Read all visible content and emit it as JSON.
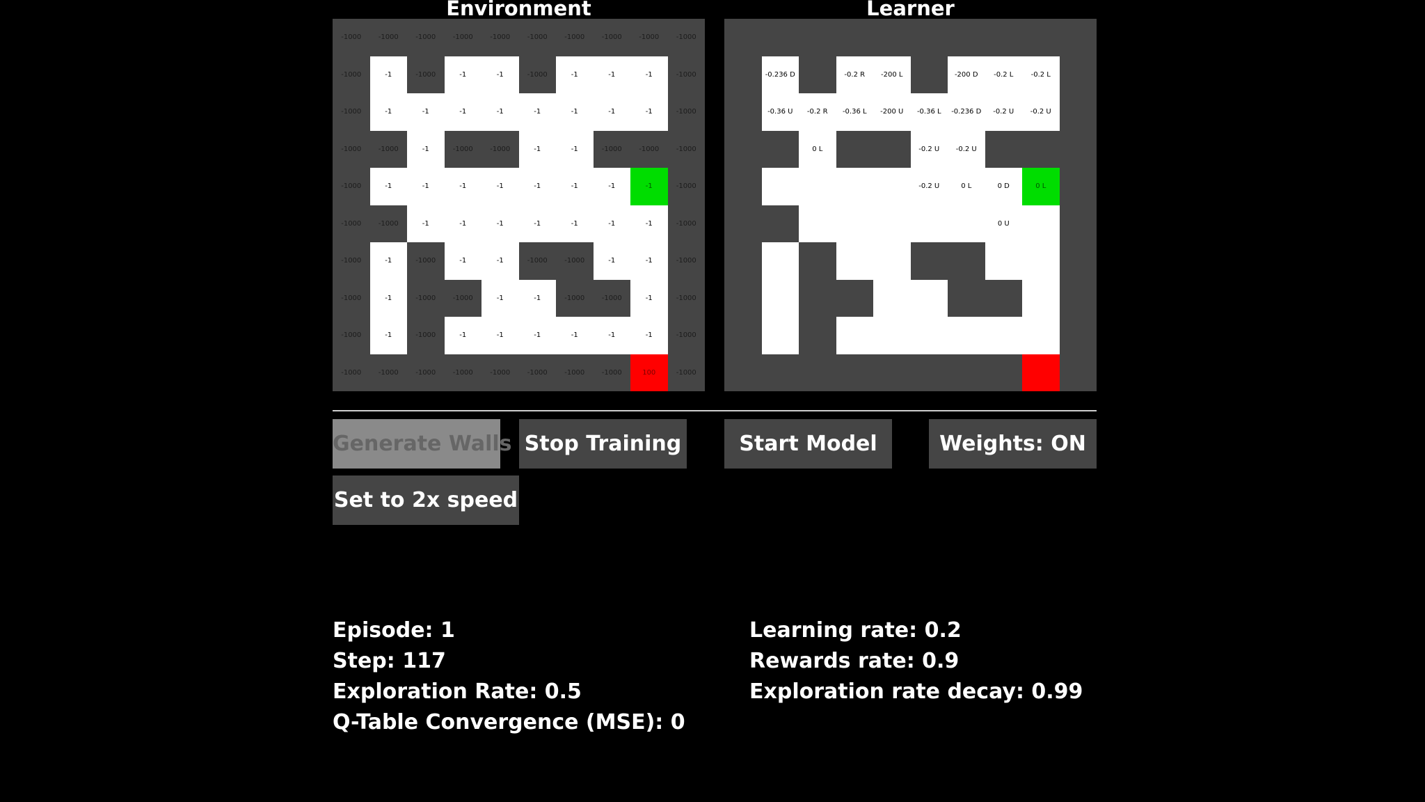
{
  "panels": {
    "environment_title": "Environment",
    "learner_title": "Learner"
  },
  "colors": {
    "background": "#000000",
    "wall": "#454545",
    "open": "#ffffff",
    "goal": "#00dd00",
    "pit": "#ff0000",
    "button": "#454545",
    "button_disabled": "#8a8a8a"
  },
  "environment_grid": [
    [
      "-1000",
      "-1000",
      "-1000",
      "-1000",
      "-1000",
      "-1000",
      "-1000",
      "-1000",
      "-1000",
      "-1000"
    ],
    [
      "-1000",
      "-1",
      "-1000",
      "-1",
      "-1",
      "-1000",
      "-1",
      "-1",
      "-1",
      "-1000"
    ],
    [
      "-1000",
      "-1",
      "-1",
      "-1",
      "-1",
      "-1",
      "-1",
      "-1",
      "-1",
      "-1000"
    ],
    [
      "-1000",
      "-1000",
      "-1",
      "-1000",
      "-1000",
      "-1",
      "-1",
      "-1000",
      "-1000",
      "-1000"
    ],
    [
      "-1000",
      "-1",
      "-1",
      "-1",
      "-1",
      "-1",
      "-1",
      "-1",
      "-1",
      "-1000"
    ],
    [
      "-1000",
      "-1000",
      "-1",
      "-1",
      "-1",
      "-1",
      "-1",
      "-1",
      "-1",
      "-1000"
    ],
    [
      "-1000",
      "-1",
      "-1000",
      "-1",
      "-1",
      "-1000",
      "-1000",
      "-1",
      "-1",
      "-1000"
    ],
    [
      "-1000",
      "-1",
      "-1000",
      "-1000",
      "-1",
      "-1",
      "-1000",
      "-1000",
      "-1",
      "-1000"
    ],
    [
      "-1000",
      "-1",
      "-1000",
      "-1",
      "-1",
      "-1",
      "-1",
      "-1",
      "-1",
      "-1000"
    ],
    [
      "-1000",
      "-1000",
      "-1000",
      "-1000",
      "-1000",
      "-1000",
      "-1000",
      "-1000",
      "100",
      "-1000"
    ]
  ],
  "learner_grid": [
    [
      "",
      "",
      "",
      "",
      "",
      "",
      "",
      "",
      "",
      ""
    ],
    [
      "",
      "-0.236 D",
      "",
      "-0.2 R",
      "-200 L",
      "",
      "-200 D",
      "-0.2 L",
      "-0.2 L",
      ""
    ],
    [
      "",
      "-0.36 U",
      "-0.2 R",
      "-0.36 L",
      "-200 U",
      "-0.36 L",
      "-0.236 D",
      "-0.2 U",
      "-0.2 U",
      ""
    ],
    [
      "",
      "",
      "0 L",
      "",
      "",
      "-0.2 U",
      "-0.2 U",
      "",
      "",
      ""
    ],
    [
      "",
      "",
      "",
      "",
      "",
      "-0.2 U",
      "0 L",
      "0 D",
      "0 L",
      ""
    ],
    [
      "",
      "",
      "",
      "",
      "",
      "",
      "",
      "0 U",
      "",
      ""
    ],
    [
      "",
      "",
      "",
      "",
      "",
      "",
      "",
      "",
      "",
      ""
    ],
    [
      "",
      "",
      "",
      "",
      "",
      "",
      "",
      "",
      "",
      ""
    ],
    [
      "",
      "",
      "",
      "",
      "",
      "",
      "",
      "",
      "",
      ""
    ],
    [
      "",
      "",
      "",
      "",
      "",
      "",
      "",
      "",
      "",
      ""
    ]
  ],
  "learner_layout": [
    "WWWWWWWWWW",
    "WOWOOWOOOW",
    "WOOOOOOOOW",
    "WWOWWOOWWW",
    "WOOOOOOOGW",
    "WWOOOOOOOW",
    "WOWOOWWOOW",
    "WOWWOOWWOW",
    "WOWOOOOOOW",
    "WWWWWWWWPW"
  ],
  "buttons": {
    "generate_walls": "Generate Walls",
    "stop_training": "Stop Training",
    "start_model": "Start Model",
    "weights": "Weights: ON",
    "speed": "Set to 2x speed"
  },
  "stats": {
    "episode": "Episode: 1",
    "step": "Step: 117",
    "exploration_rate": "Exploration Rate: 0.5",
    "convergence": "Q-Table Convergence (MSE): 0",
    "learning_rate": "Learning rate: 0.2",
    "rewards_rate": "Rewards rate: 0.9",
    "exploration_decay": "Exploration rate decay: 0.99"
  }
}
